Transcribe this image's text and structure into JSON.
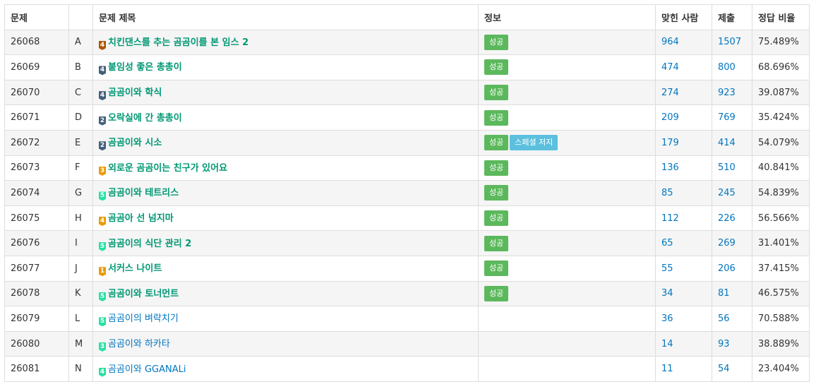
{
  "headers": {
    "id": "문제",
    "letter": "",
    "title": "문제 제목",
    "info": "정보",
    "solved": "맞힌 사람",
    "submit": "제출",
    "ratio": "정답 비율"
  },
  "tier_colors": {
    "bronze": "#ad5600",
    "silver": "#435f7a",
    "gold": "#ec9a00",
    "platinum": "#27e2a4"
  },
  "rows": [
    {
      "id": "26068",
      "letter": "A",
      "tier": "bronze",
      "tier_num": "4",
      "title": "치킨댄스를 추는 곰곰이를 본 임스 2",
      "solved_by_me": true,
      "badges": [
        "성공"
      ],
      "solved": "964",
      "submit": "1507",
      "ratio": "75.489%"
    },
    {
      "id": "26069",
      "letter": "B",
      "tier": "silver",
      "tier_num": "4",
      "title": "붙임성 좋은 총총이",
      "solved_by_me": true,
      "badges": [
        "성공"
      ],
      "solved": "474",
      "submit": "800",
      "ratio": "68.696%"
    },
    {
      "id": "26070",
      "letter": "C",
      "tier": "silver",
      "tier_num": "4",
      "title": "곰곰이와 학식",
      "solved_by_me": true,
      "badges": [
        "성공"
      ],
      "solved": "274",
      "submit": "923",
      "ratio": "39.087%"
    },
    {
      "id": "26071",
      "letter": "D",
      "tier": "silver",
      "tier_num": "2",
      "title": "오락실에 간 총총이",
      "solved_by_me": true,
      "badges": [
        "성공"
      ],
      "solved": "209",
      "submit": "769",
      "ratio": "35.424%"
    },
    {
      "id": "26072",
      "letter": "E",
      "tier": "silver",
      "tier_num": "2",
      "title": "곰곰이와 시소",
      "solved_by_me": true,
      "badges": [
        "성공",
        "스페셜 저지"
      ],
      "solved": "179",
      "submit": "414",
      "ratio": "54.079%"
    },
    {
      "id": "26073",
      "letter": "F",
      "tier": "gold",
      "tier_num": "3",
      "title": "외로운 곰곰이는 친구가 있어요",
      "solved_by_me": true,
      "badges": [
        "성공"
      ],
      "solved": "136",
      "submit": "510",
      "ratio": "40.841%"
    },
    {
      "id": "26074",
      "letter": "G",
      "tier": "platinum",
      "tier_num": "5",
      "title": "곰곰이와 테트리스",
      "solved_by_me": true,
      "badges": [
        "성공"
      ],
      "solved": "85",
      "submit": "245",
      "ratio": "54.839%"
    },
    {
      "id": "26075",
      "letter": "H",
      "tier": "gold",
      "tier_num": "4",
      "title": "곰곰아 선 넘지마",
      "solved_by_me": true,
      "badges": [
        "성공"
      ],
      "solved": "112",
      "submit": "226",
      "ratio": "56.566%"
    },
    {
      "id": "26076",
      "letter": "I",
      "tier": "platinum",
      "tier_num": "5",
      "title": "곰곰이의 식단 관리 2",
      "solved_by_me": true,
      "badges": [
        "성공"
      ],
      "solved": "65",
      "submit": "269",
      "ratio": "31.401%"
    },
    {
      "id": "26077",
      "letter": "J",
      "tier": "gold",
      "tier_num": "1",
      "title": "서커스 나이트",
      "solved_by_me": true,
      "badges": [
        "성공"
      ],
      "solved": "55",
      "submit": "206",
      "ratio": "37.415%"
    },
    {
      "id": "26078",
      "letter": "K",
      "tier": "platinum",
      "tier_num": "5",
      "title": "곰곰이와 토너먼트",
      "solved_by_me": true,
      "badges": [
        "성공"
      ],
      "solved": "34",
      "submit": "81",
      "ratio": "46.575%"
    },
    {
      "id": "26079",
      "letter": "L",
      "tier": "platinum",
      "tier_num": "5",
      "title": "곰곰이의 벼락치기",
      "solved_by_me": false,
      "badges": [],
      "solved": "36",
      "submit": "56",
      "ratio": "70.588%"
    },
    {
      "id": "26080",
      "letter": "M",
      "tier": "platinum",
      "tier_num": "3",
      "title": "곰곰이와 하카타",
      "solved_by_me": false,
      "badges": [],
      "solved": "14",
      "submit": "93",
      "ratio": "38.889%"
    },
    {
      "id": "26081",
      "letter": "N",
      "tier": "platinum",
      "tier_num": "4",
      "title": "곰곰이와 GGANALi",
      "solved_by_me": false,
      "badges": [],
      "solved": "11",
      "submit": "54",
      "ratio": "23.404%"
    }
  ]
}
